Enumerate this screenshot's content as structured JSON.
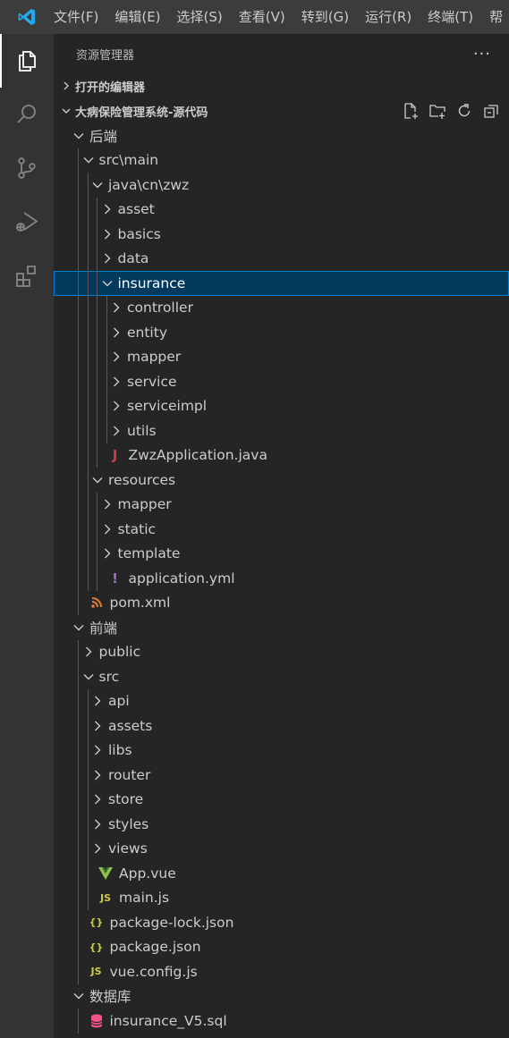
{
  "menu": [
    "文件(F)",
    "编辑(E)",
    "选择(S)",
    "查看(V)",
    "转到(G)",
    "运行(R)",
    "终端(T)",
    "帮"
  ],
  "explorer": {
    "title": "资源管理器",
    "more": "···",
    "open_editors": "打开的编辑器",
    "workspace": "大病保险管理系统-源代码"
  },
  "tree": [
    {
      "label": "后端",
      "depth": 0,
      "kind": "folder",
      "open": true
    },
    {
      "label": "src\\main",
      "depth": 1,
      "kind": "folder",
      "open": true
    },
    {
      "label": "java\\cn\\zwz",
      "depth": 2,
      "kind": "folder",
      "open": true
    },
    {
      "label": "asset",
      "depth": 3,
      "kind": "folder",
      "open": false
    },
    {
      "label": "basics",
      "depth": 3,
      "kind": "folder",
      "open": false
    },
    {
      "label": "data",
      "depth": 3,
      "kind": "folder",
      "open": false
    },
    {
      "label": "insurance",
      "depth": 3,
      "kind": "folder",
      "open": true,
      "selected": true
    },
    {
      "label": "controller",
      "depth": 4,
      "kind": "folder",
      "open": false
    },
    {
      "label": "entity",
      "depth": 4,
      "kind": "folder",
      "open": false
    },
    {
      "label": "mapper",
      "depth": 4,
      "kind": "folder",
      "open": false
    },
    {
      "label": "service",
      "depth": 4,
      "kind": "folder",
      "open": false
    },
    {
      "label": "serviceimpl",
      "depth": 4,
      "kind": "folder",
      "open": false
    },
    {
      "label": "utils",
      "depth": 4,
      "kind": "folder",
      "open": false
    },
    {
      "label": "ZwzApplication.java",
      "depth": 3,
      "kind": "java"
    },
    {
      "label": "resources",
      "depth": 2,
      "kind": "folder",
      "open": true
    },
    {
      "label": "mapper",
      "depth": 3,
      "kind": "folder",
      "open": false
    },
    {
      "label": "static",
      "depth": 3,
      "kind": "folder",
      "open": false
    },
    {
      "label": "template",
      "depth": 3,
      "kind": "folder",
      "open": false
    },
    {
      "label": "application.yml",
      "depth": 3,
      "kind": "yml"
    },
    {
      "label": "pom.xml",
      "depth": 1,
      "kind": "xml"
    },
    {
      "label": "前端",
      "depth": 0,
      "kind": "folder",
      "open": true
    },
    {
      "label": "public",
      "depth": 1,
      "kind": "folder",
      "open": false
    },
    {
      "label": "src",
      "depth": 1,
      "kind": "folder",
      "open": true
    },
    {
      "label": "api",
      "depth": 2,
      "kind": "folder",
      "open": false
    },
    {
      "label": "assets",
      "depth": 2,
      "kind": "folder",
      "open": false
    },
    {
      "label": "libs",
      "depth": 2,
      "kind": "folder",
      "open": false
    },
    {
      "label": "router",
      "depth": 2,
      "kind": "folder",
      "open": false
    },
    {
      "label": "store",
      "depth": 2,
      "kind": "folder",
      "open": false
    },
    {
      "label": "styles",
      "depth": 2,
      "kind": "folder",
      "open": false
    },
    {
      "label": "views",
      "depth": 2,
      "kind": "folder",
      "open": false
    },
    {
      "label": "App.vue",
      "depth": 2,
      "kind": "vue"
    },
    {
      "label": "main.js",
      "depth": 2,
      "kind": "js"
    },
    {
      "label": "package-lock.json",
      "depth": 1,
      "kind": "json"
    },
    {
      "label": "package.json",
      "depth": 1,
      "kind": "json"
    },
    {
      "label": "vue.config.js",
      "depth": 1,
      "kind": "js"
    },
    {
      "label": "数据库",
      "depth": 0,
      "kind": "folder",
      "open": true
    },
    {
      "label": "insurance_V5.sql",
      "depth": 1,
      "kind": "sql"
    }
  ],
  "file_icons": {
    "java": {
      "glyph": "J",
      "color": "#cc3e44"
    },
    "yml": {
      "glyph": "!",
      "color": "#a074c4"
    },
    "xml": {
      "glyph": "rss-icon",
      "color": "#e37933"
    },
    "vue": {
      "glyph": "vue-icon",
      "color": "#8dc149"
    },
    "js": {
      "glyph": "JS",
      "color": "#cbcb41"
    },
    "json": {
      "glyph": "{}",
      "color": "#cbcb41"
    },
    "sql": {
      "glyph": "database-icon",
      "color": "#f55385"
    }
  },
  "colors": {
    "accent": "#007acc",
    "selection_bg": "#04395e",
    "selection_border": "#007fd4"
  }
}
